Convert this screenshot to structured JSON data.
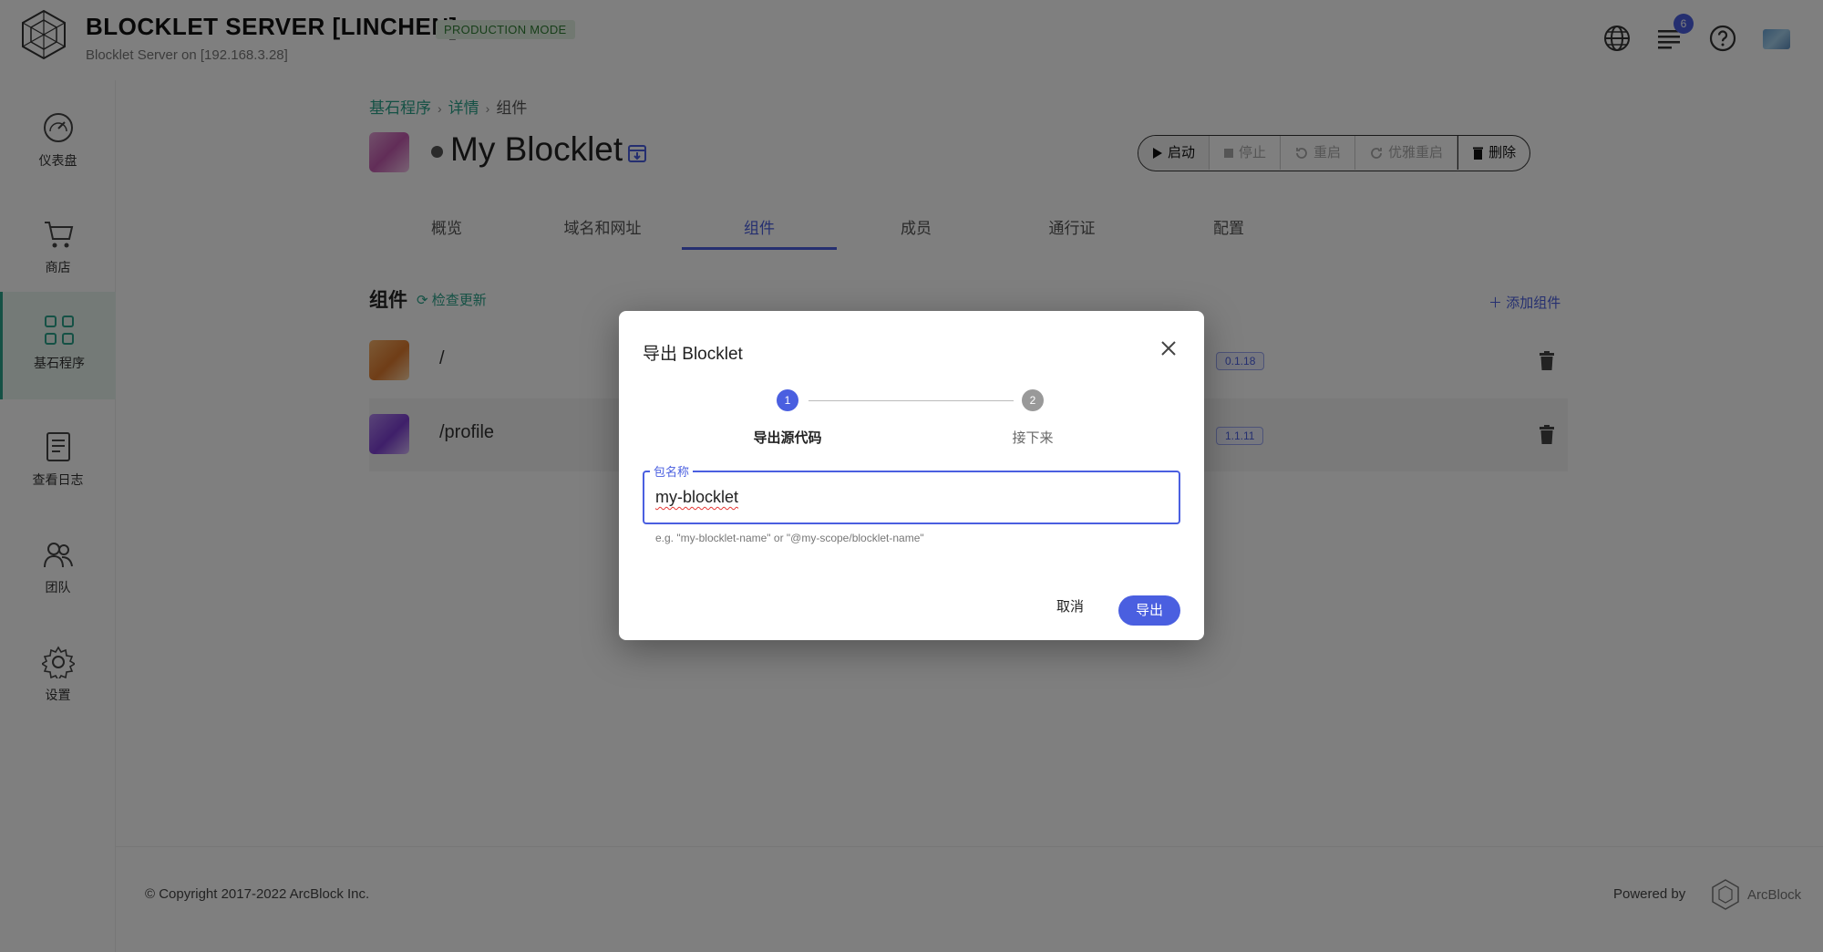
{
  "header": {
    "title": "BLOCKLET SERVER [LINCHEN]",
    "mode_badge": "PRODUCTION MODE",
    "subtitle": "Blocklet Server on [192.168.3.28]",
    "notification_count": "6"
  },
  "sidebar": {
    "items": [
      {
        "label": "仪表盘",
        "icon": "dashboard-icon"
      },
      {
        "label": "商店",
        "icon": "cart-icon"
      },
      {
        "label": "基石程序",
        "icon": "apps-grid-icon"
      },
      {
        "label": "查看日志",
        "icon": "logs-icon"
      },
      {
        "label": "团队",
        "icon": "team-icon"
      },
      {
        "label": "设置",
        "icon": "gear-icon"
      }
    ]
  },
  "breadcrumb": {
    "items": [
      "基石程序",
      "详情",
      "组件"
    ]
  },
  "page": {
    "title": "My Blocklet",
    "actions": [
      "启动",
      "停止",
      "重启",
      "优雅重启",
      "删除"
    ]
  },
  "tabs": [
    "概览",
    "域名和网址",
    "组件",
    "成员",
    "通行证",
    "配置"
  ],
  "components": {
    "title": "组件",
    "check_update": "检查更新",
    "add": "添加组件",
    "rows": [
      {
        "name": "/",
        "version": "0.1.18"
      },
      {
        "name": "/profile",
        "version": "1.1.11"
      }
    ]
  },
  "footer": {
    "copyright": "© Copyright 2017-2022  ArcBlock Inc.",
    "powered_by": "Powered by",
    "brand": "ArcBlock"
  },
  "dialog": {
    "title": "导出 Blocklet",
    "steps": [
      {
        "num": "1",
        "label": "导出源代码"
      },
      {
        "num": "2",
        "label": "接下来"
      }
    ],
    "field_label": "包名称",
    "field_value": "my-blocklet",
    "field_hint": "e.g. \"my-blocklet-name\" or \"@my-scope/blocklet-name\"",
    "cancel": "取消",
    "export": "导出"
  },
  "colors": {
    "primary": "#4a5fe0",
    "accent_green": "#2aa38a",
    "overlay": "rgba(0,0,0,0.5)"
  }
}
